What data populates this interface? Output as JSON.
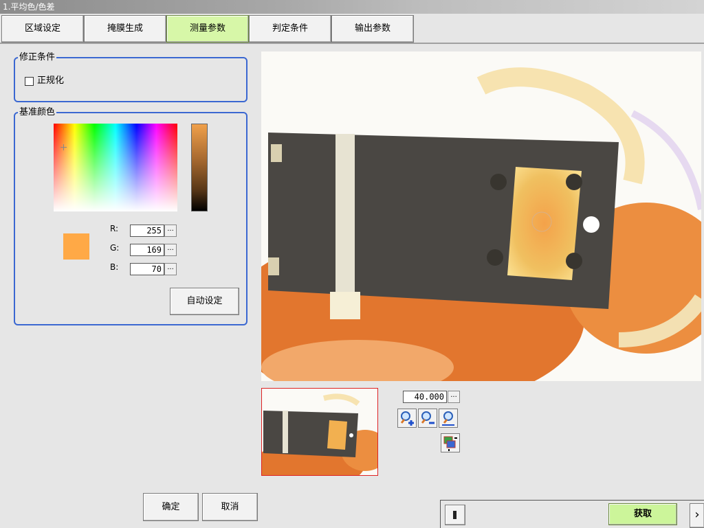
{
  "window": {
    "title": "1.平均色/色差"
  },
  "tabs": [
    {
      "label": "区域设定"
    },
    {
      "label": "掩膜生成"
    },
    {
      "label": "测量参数"
    },
    {
      "label": "判定条件"
    },
    {
      "label": "输出参数"
    }
  ],
  "active_tab_index": 2,
  "correction": {
    "title": "修正条件",
    "normalize_label": "正规化",
    "normalize_checked": false
  },
  "reference_color": {
    "title": "基准颜色",
    "r_label": "R:",
    "g_label": "G:",
    "b_label": "B:",
    "r": "255",
    "g": "169",
    "b": "70",
    "swatch_color": "#ffa946",
    "ellipsis": "...",
    "auto_button": "自动设定"
  },
  "zoom": {
    "value": "40.000",
    "ellipsis": "..."
  },
  "footer": {
    "ok_label": "确定",
    "cancel_label": "取消",
    "acquire_label": "获取",
    "next_arrow": "›"
  },
  "colors": {
    "accent_blue": "#3a67d1",
    "active_tab": "#d7f7a8",
    "acquire_green": "#ccf59a"
  }
}
